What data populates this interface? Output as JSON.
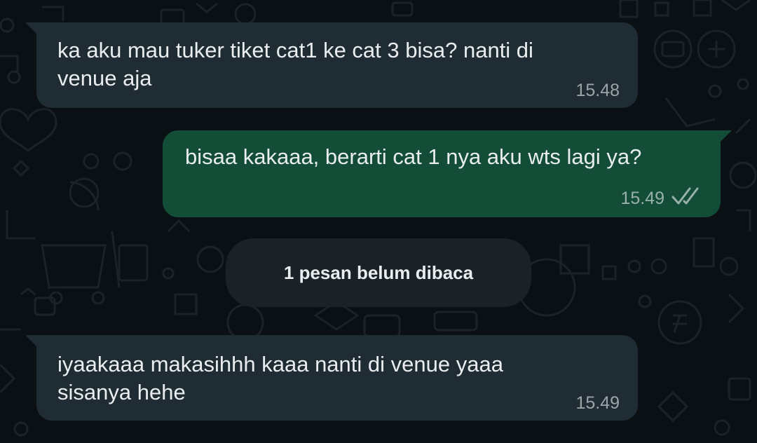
{
  "messages": [
    {
      "direction": "incoming",
      "text": "ka aku mau tuker tiket cat1 ke cat 3 bisa? nanti di\nvenue aja",
      "time": "15.48"
    },
    {
      "direction": "outgoing",
      "text": "bisaa kakaaa, berarti cat 1 nya aku wts lagi ya?",
      "time": "15.49",
      "status_icon": "double-check-icon"
    },
    {
      "direction": "incoming",
      "text": "iyaakaaa makasihhh kaaa nanti di venue yaaa\nsisanya hehe",
      "time": "15.49"
    }
  ],
  "unread_divider": {
    "text": "1 pesan belum dibaca"
  },
  "colors": {
    "background": "#0b1014",
    "incoming_bubble": "#1f2c33",
    "outgoing_bubble": "#134d37",
    "divider_pill": "#1a2227",
    "text": "#e9edef"
  }
}
